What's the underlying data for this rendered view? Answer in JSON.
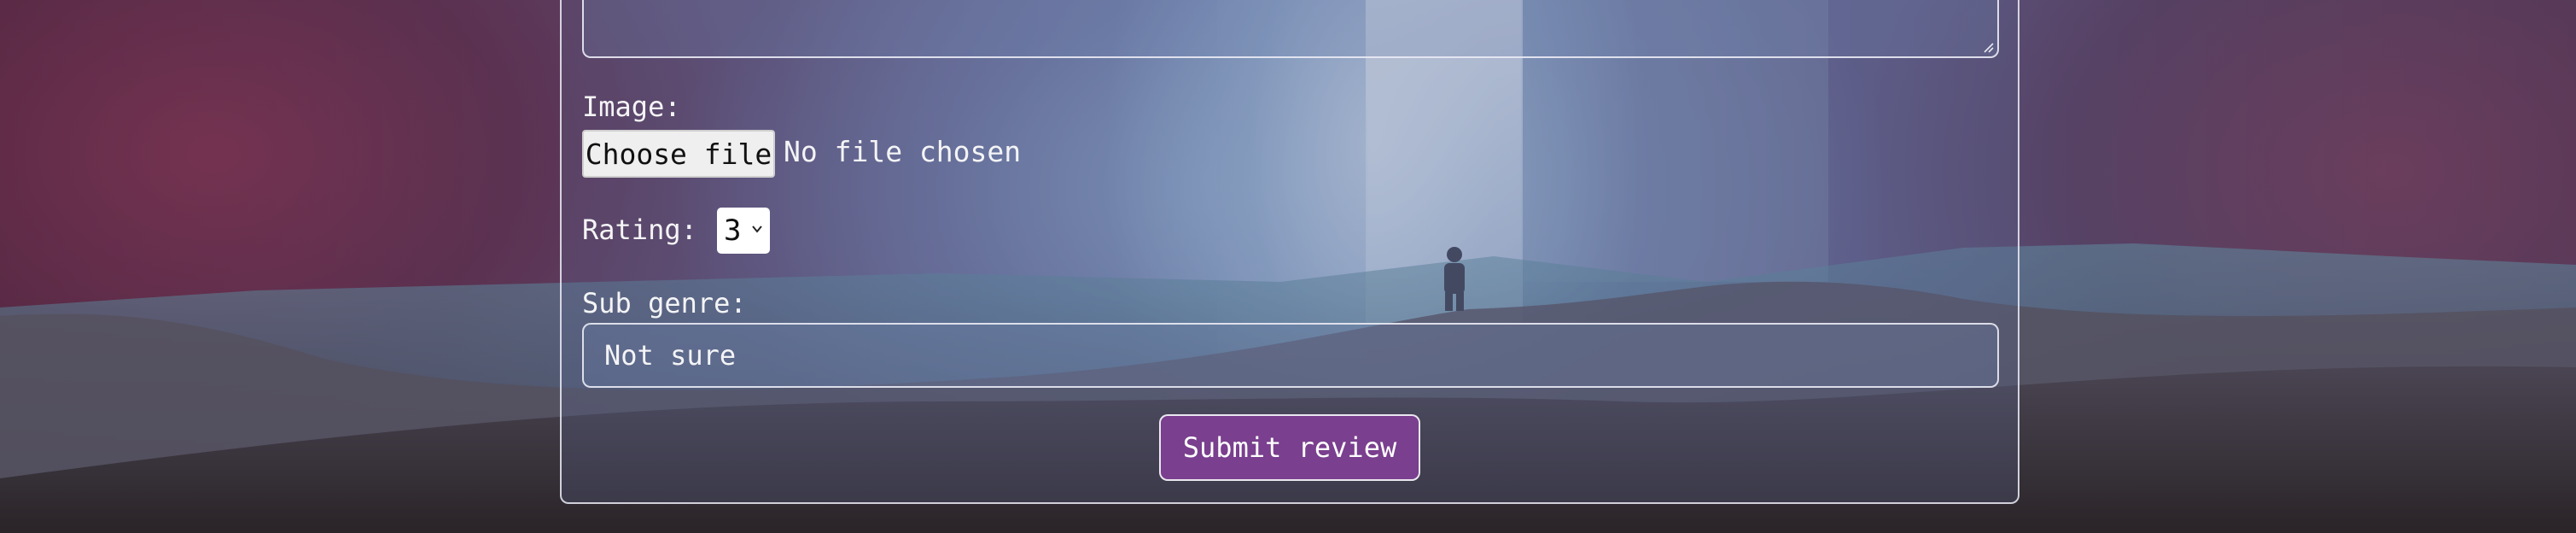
{
  "form": {
    "image_label": "Image:",
    "file_button_label": "Choose file",
    "file_status": "No file chosen",
    "rating_label": "Rating:",
    "rating_value": "3",
    "subgenre_label": "Sub genre:",
    "subgenre_value": "Not sure",
    "submit_label": "Submit review"
  },
  "icons": {
    "select_arrow": "chevron-down-icon",
    "textarea_grip": "resize-grip-icon"
  },
  "colors": {
    "submit_bg": "#7a3f8e",
    "border": "#ebebf5"
  }
}
